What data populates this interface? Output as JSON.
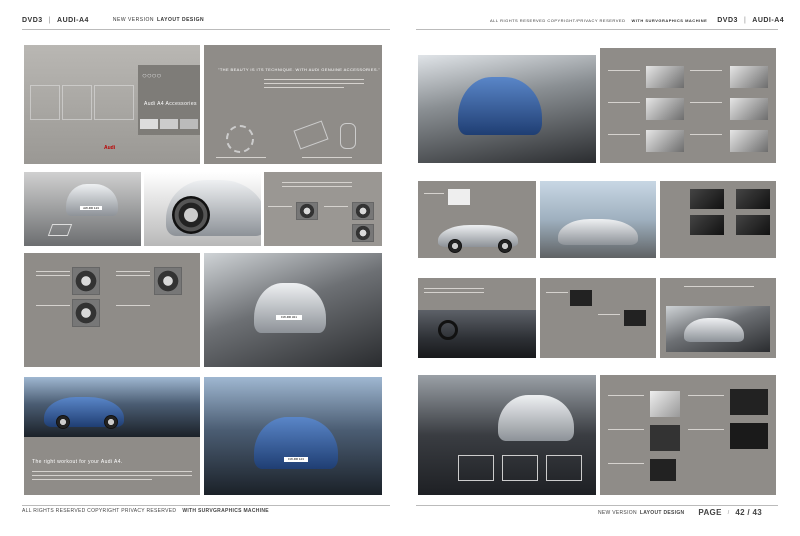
{
  "header": {
    "left_code": "DVD3",
    "left_brand": "AUDI-A4",
    "center_prefix": "NEW VERSION",
    "center_bold": "LAYOUT DESIGN",
    "right_rights": "ALL RIGHTS RESERVED COPYRIGHT/PRIVACY RESERVED",
    "right_bold": "WITH SURVGRAPHICS MACHINE",
    "right_code": "DVD3",
    "right_brand": "AUDI-A4"
  },
  "left_page": {
    "accessories_title": "Audi A4 Accessories",
    "quote": "\"THE BEAUTY IS ITS TECHNIQUE. WITH AUDI GENUINE ACCESSORIES.\"",
    "logo_text": "Audi",
    "plate_a": "AW-RR 123",
    "plate_b": "FW-RR 321",
    "right_workout": "The right workout for your Audi A4."
  },
  "right_page": {
    "plate_c": "FW-RR 123"
  },
  "footer": {
    "left_rights": "ALL RIGHTS RESERVED COPYRIGHT PRIVACY RESERVED",
    "left_bold": "WITH SURVGRAPHICS MACHINE",
    "right_prefix": "NEW VERSION",
    "right_bold": "LAYOUT DESIGN",
    "page_label": "PAGE",
    "page_number": "42 / 43"
  }
}
